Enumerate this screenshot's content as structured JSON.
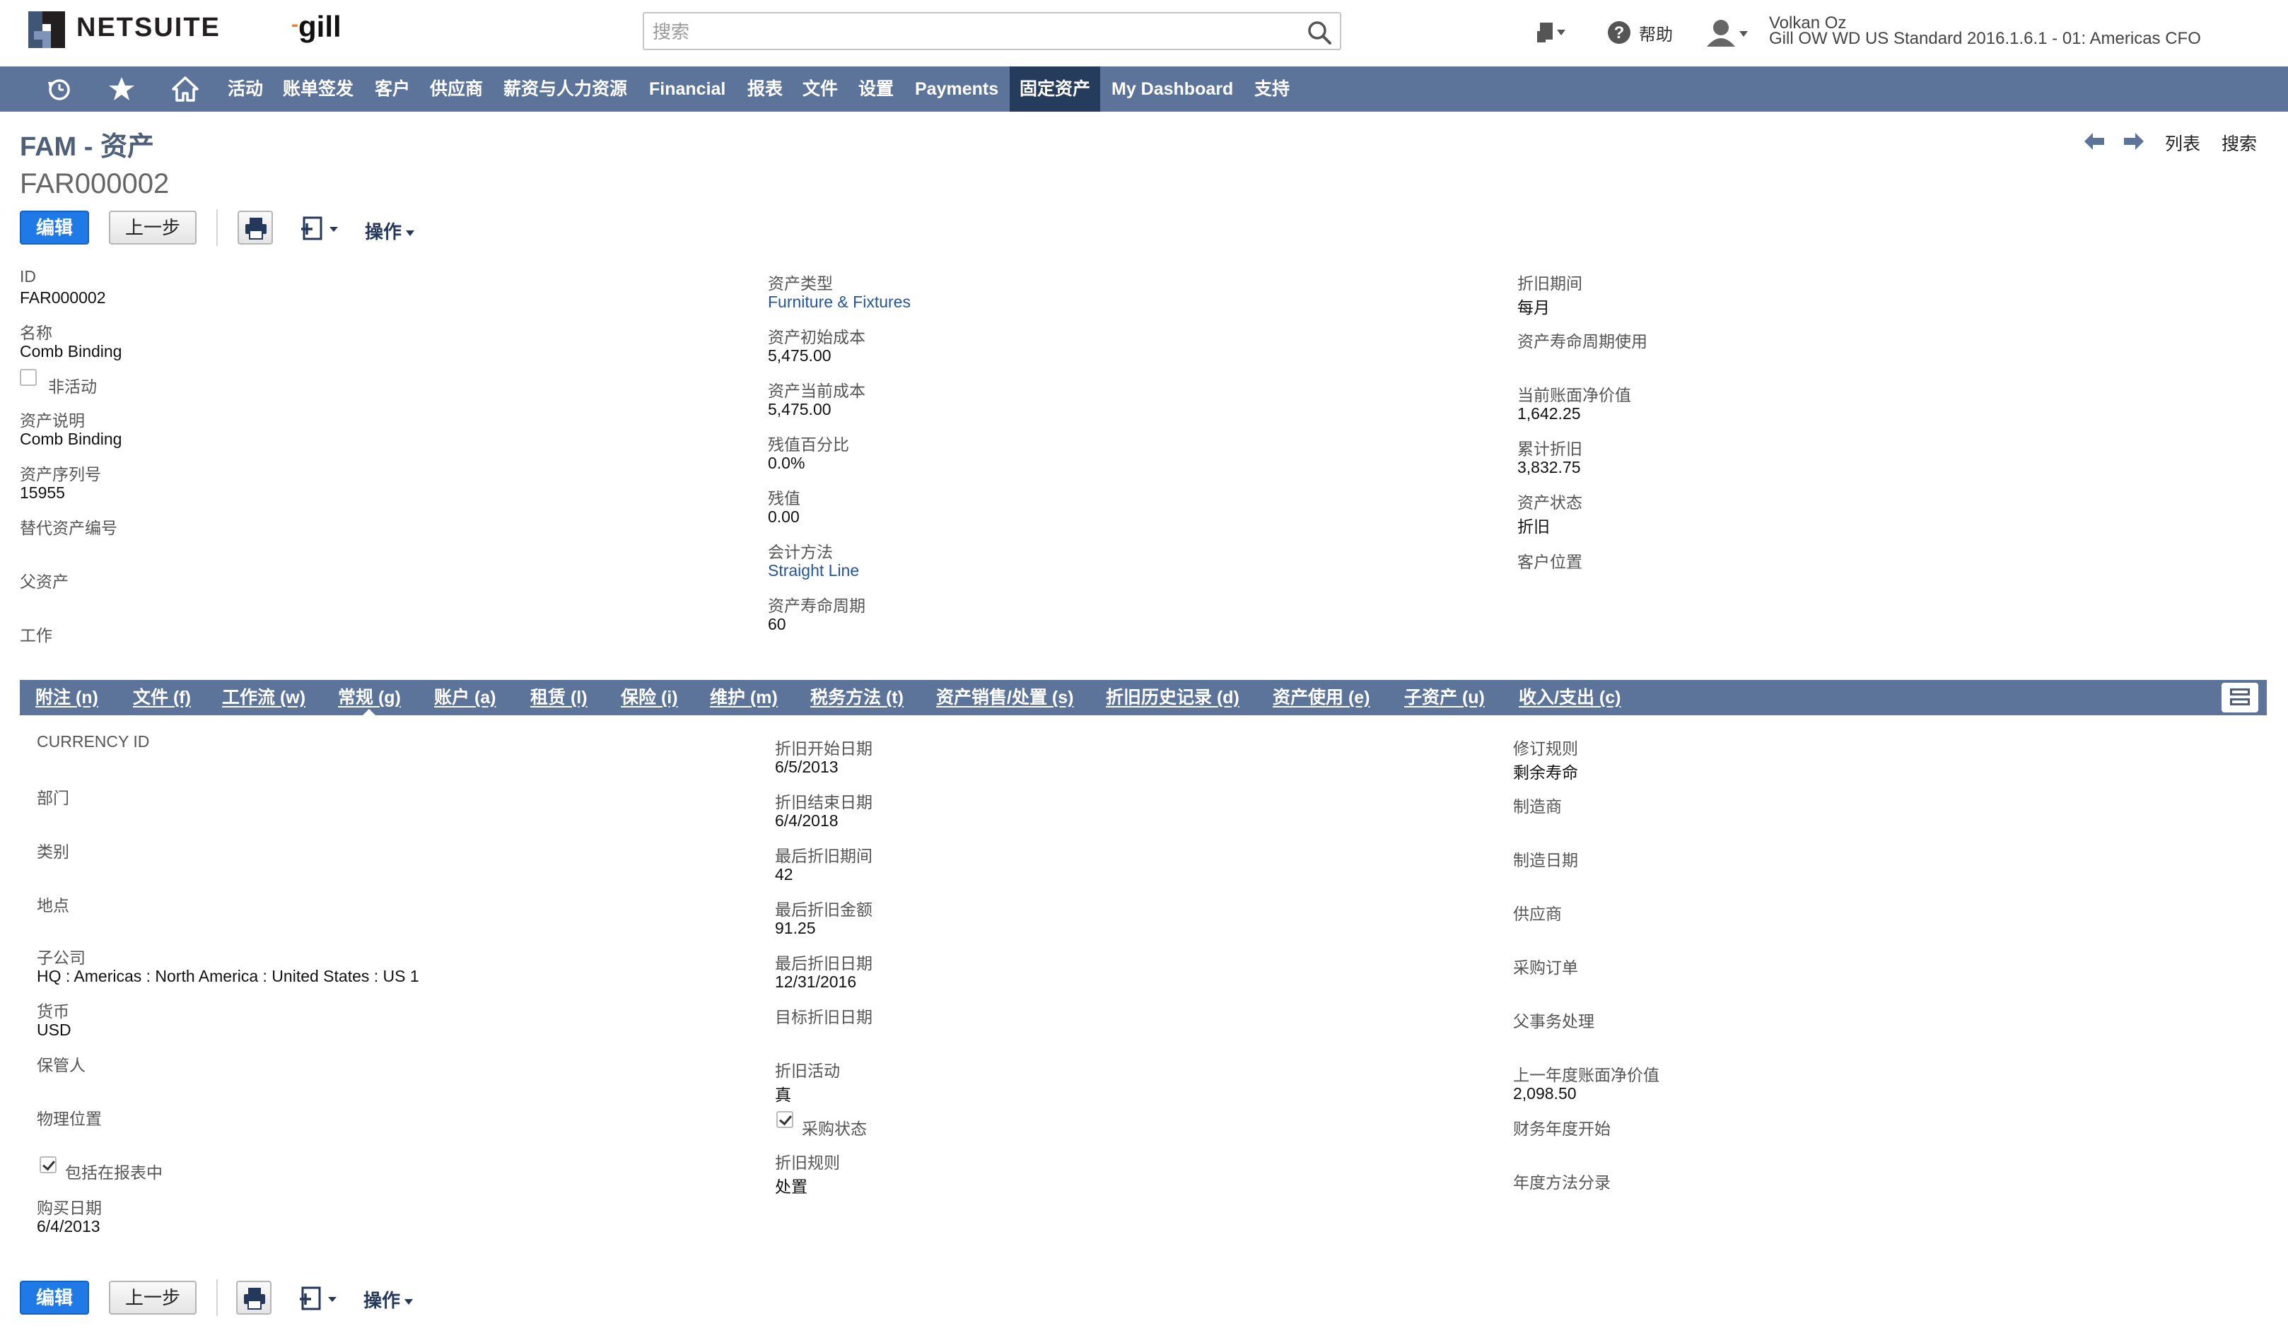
{
  "header": {
    "brand": "NETSUITE",
    "company": "gill",
    "search_placeholder": "搜索",
    "help_label": "帮助",
    "user_name": "Volkan Oz",
    "user_role": "Gill OW WD US Standard 2016.1.6.1 - 01: Americas CFO"
  },
  "nav": {
    "items": [
      "活动",
      "账单签发",
      "客户",
      "供应商",
      "薪资与人力资源",
      "Financial",
      "报表",
      "文件",
      "设置",
      "Payments",
      "固定资产",
      "My Dashboard",
      "支持"
    ],
    "active": "固定资产"
  },
  "page": {
    "title": "FAM - 资产",
    "record_id": "FAR000002",
    "list_link": "列表",
    "search_link": "搜索"
  },
  "buttons": {
    "edit": "编辑",
    "back": "上一步",
    "actions": "操作"
  },
  "main_fields": {
    "col1": {
      "id_label": "ID",
      "id_value": "FAR000002",
      "name_label": "名称",
      "name_value": "Comb Binding",
      "inactive_label": "非活动",
      "desc_label": "资产说明",
      "desc_value": "Comb Binding",
      "serial_label": "资产序列号",
      "serial_value": "15955",
      "alt_label": "替代资产编号",
      "parent_label": "父资产",
      "work_label": "工作"
    },
    "col2": {
      "type_label": "资产类型",
      "type_value": "Furniture & Fixtures",
      "orig_cost_label": "资产初始成本",
      "orig_cost_value": "5,475.00",
      "cur_cost_label": "资产当前成本",
      "cur_cost_value": "5,475.00",
      "residual_pct_label": "残值百分比",
      "residual_pct_value": "0.0%",
      "residual_label": "残值",
      "residual_value": "0.00",
      "method_label": "会计方法",
      "method_value": "Straight Line",
      "lifetime_label": "资产寿命周期",
      "lifetime_value": "60"
    },
    "col3": {
      "period_label": "折旧期间",
      "period_value": "每月",
      "lifetime_usage_label": "资产寿命周期使用",
      "nbv_label": "当前账面净价值",
      "nbv_value": "1,642.25",
      "accum_label": "累计折旧",
      "accum_value": "3,832.75",
      "status_label": "资产状态",
      "status_value": "折旧",
      "customer_loc_label": "客户位置"
    }
  },
  "subtabs": {
    "items": [
      "附注 (n)",
      "文件 (f)",
      "工作流 (w)",
      "常规 (g)",
      "账户 (a)",
      "租赁 (l)",
      "保险 (i)",
      "维护 (m)",
      "税务方法 (t)",
      "资产销售/处置 (s)",
      "折旧历史记录 (d)",
      "资产使用 (e)",
      "子资产 (u)",
      "收入/支出 (c)"
    ],
    "active": "常规 (g)"
  },
  "general": {
    "col1": {
      "currency_id_label": "CURRENCY ID",
      "dept_label": "部门",
      "class_label": "类别",
      "location_label": "地点",
      "subsidiary_label": "子公司",
      "subsidiary_value": "HQ : Americas : North America : United States : US 1",
      "currency_label": "货币",
      "currency_value": "USD",
      "custodian_label": "保管人",
      "physical_loc_label": "物理位置",
      "include_reports_label": "包括在报表中",
      "purchase_date_label": "购买日期",
      "purchase_date_value": "6/4/2013"
    },
    "col2": {
      "dep_start_label": "折旧开始日期",
      "dep_start_value": "6/5/2013",
      "dep_end_label": "折旧结束日期",
      "dep_end_value": "6/4/2018",
      "last_period_label": "最后折旧期间",
      "last_period_value": "42",
      "last_amount_label": "最后折旧金额",
      "last_amount_value": "91.25",
      "last_date_label": "最后折旧日期",
      "last_date_value": "12/31/2016",
      "target_date_label": "目标折旧日期",
      "dep_active_label": "折旧活动",
      "dep_active_value": "真",
      "purchase_status_label": "采购状态",
      "dep_rule_label": "折旧规则",
      "dep_rule_value": "处置"
    },
    "col3": {
      "revision_label": "修订规则",
      "revision_value": "剩余寿命",
      "manufacturer_label": "制造商",
      "mfg_date_label": "制造日期",
      "supplier_label": "供应商",
      "po_label": "采购订单",
      "parent_tx_label": "父事务处理",
      "prior_nbv_label": "上一年度账面净价值",
      "prior_nbv_value": "2,098.50",
      "fy_start_label": "财务年度开始",
      "annual_entry_label": "年度方法分录"
    }
  },
  "colors": {
    "nav_bg": "#5c7499",
    "nav_active": "#263c5c",
    "primary_button": "#1f7ae8",
    "link": "#24559c",
    "brand_accent": "#f57f20"
  }
}
